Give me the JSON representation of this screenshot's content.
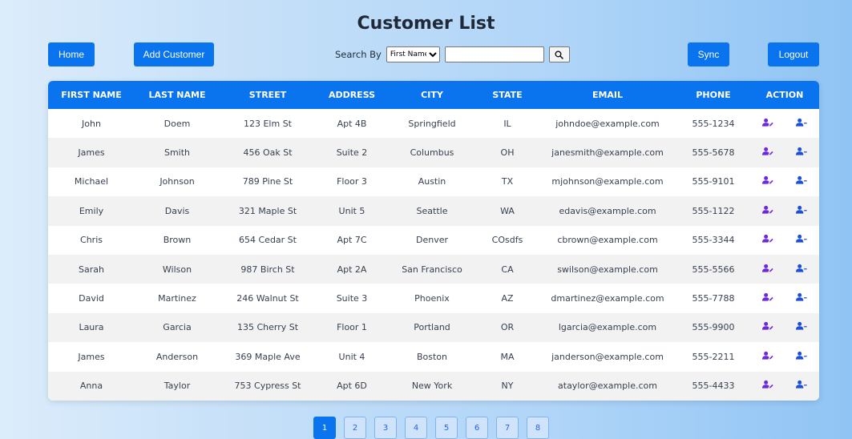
{
  "header": {
    "title": "Customer List"
  },
  "toolbar": {
    "home_label": "Home",
    "add_customer_label": "Add Customer",
    "search_by_label": "Search By",
    "search_field_selected": "First Name",
    "search_input_value": "",
    "sync_label": "Sync",
    "logout_label": "Logout"
  },
  "table": {
    "columns": [
      "FIRST NAME",
      "LAST NAME",
      "STREET",
      "ADDRESS",
      "CITY",
      "STATE",
      "EMAIL",
      "PHONE",
      "ACTION"
    ],
    "rows": [
      [
        "John",
        "Doem",
        "123 Elm St",
        "Apt 4B",
        "Springfield",
        "IL",
        "johndoe@example.com",
        "555-1234"
      ],
      [
        "James",
        "Smith",
        "456 Oak St",
        "Suite 2",
        "Columbus",
        "OH",
        "janesmith@example.com",
        "555-5678"
      ],
      [
        "Michael",
        "Johnson",
        "789 Pine St",
        "Floor 3",
        "Austin",
        "TX",
        "mjohnson@example.com",
        "555-9101"
      ],
      [
        "Emily",
        "Davis",
        "321 Maple St",
        "Unit 5",
        "Seattle",
        "WA",
        "edavis@example.com",
        "555-1122"
      ],
      [
        "Chris",
        "Brown",
        "654 Cedar St",
        "Apt 7C",
        "Denver",
        "COsdfs",
        "cbrown@example.com",
        "555-3344"
      ],
      [
        "Sarah",
        "Wilson",
        "987 Birch St",
        "Apt 2A",
        "San Francisco",
        "CA",
        "swilson@example.com",
        "555-5566"
      ],
      [
        "David",
        "Martinez",
        "246 Walnut St",
        "Suite 3",
        "Phoenix",
        "AZ",
        "dmartinez@example.com",
        "555-7788"
      ],
      [
        "Laura",
        "Garcia",
        "135 Cherry St",
        "Floor 1",
        "Portland",
        "OR",
        "lgarcia@example.com",
        "555-9900"
      ],
      [
        "James",
        "Anderson",
        "369 Maple Ave",
        "Unit 4",
        "Boston",
        "MA",
        "janderson@example.com",
        "555-2211"
      ],
      [
        "Anna",
        "Taylor",
        "753 Cypress St",
        "Apt 6D",
        "New York",
        "NY",
        "ataylor@example.com",
        "555-4433"
      ]
    ],
    "actions": {
      "edit_icon": "user-edit-icon",
      "delete_icon": "user-minus-icon"
    }
  },
  "pagination": {
    "pages": [
      "1",
      "2",
      "3",
      "4",
      "5",
      "6",
      "7",
      "8"
    ],
    "current": "1"
  },
  "colors": {
    "primary": "#0a73ee",
    "edit_icon_color": "#6d28d9",
    "delete_icon_color": "#1d4ed8"
  }
}
